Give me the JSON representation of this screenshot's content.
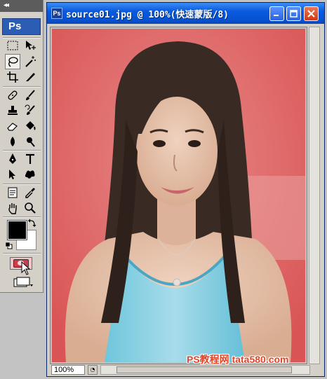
{
  "toolbox": {
    "logo": "Ps",
    "collapse_glyph": "◂◂",
    "tools": [
      {
        "name": "rectangular-marquee-tool-icon"
      },
      {
        "name": "move-tool-icon"
      },
      {
        "name": "lasso-tool-icon",
        "active": true
      },
      {
        "name": "magic-wand-tool-icon"
      },
      {
        "name": "crop-tool-icon"
      },
      {
        "name": "slice-tool-icon"
      },
      {
        "name": "healing-brush-tool-icon"
      },
      {
        "name": "brush-tool-icon"
      },
      {
        "name": "clone-stamp-tool-icon"
      },
      {
        "name": "history-brush-tool-icon"
      },
      {
        "name": "eraser-tool-icon"
      },
      {
        "name": "paint-bucket-tool-icon"
      },
      {
        "name": "blur-tool-icon"
      },
      {
        "name": "dodge-tool-icon"
      },
      {
        "name": "pen-tool-icon"
      },
      {
        "name": "type-tool-icon"
      },
      {
        "name": "path-selection-tool-icon"
      },
      {
        "name": "custom-shape-tool-icon"
      },
      {
        "name": "notes-tool-icon"
      },
      {
        "name": "eyedropper-tool-icon"
      },
      {
        "name": "hand-tool-icon"
      },
      {
        "name": "zoom-tool-icon"
      }
    ],
    "foreground_color": "#000000",
    "background_color": "#ffffff",
    "quick_mask_active": true
  },
  "document": {
    "title": "source01.jpg @ 100%(快速蒙版/8)",
    "zoom": "100%",
    "mask_color": "#e05a5a"
  },
  "watermark": "PS教程网 tata580.com"
}
